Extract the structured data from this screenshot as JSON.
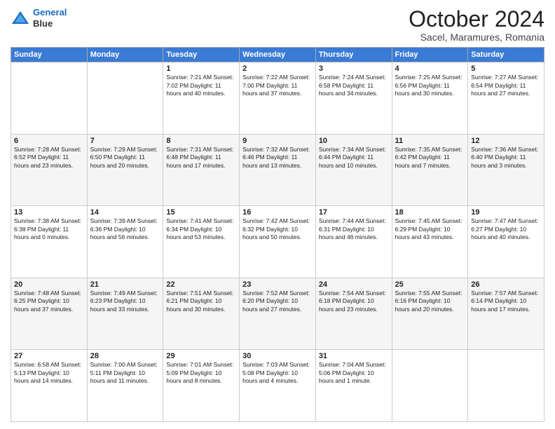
{
  "header": {
    "logo_line1": "General",
    "logo_line2": "Blue",
    "month": "October 2024",
    "location": "Sacel, Maramures, Romania"
  },
  "weekdays": [
    "Sunday",
    "Monday",
    "Tuesday",
    "Wednesday",
    "Thursday",
    "Friday",
    "Saturday"
  ],
  "weeks": [
    [
      {
        "num": "",
        "info": ""
      },
      {
        "num": "",
        "info": ""
      },
      {
        "num": "1",
        "info": "Sunrise: 7:21 AM\nSunset: 7:02 PM\nDaylight: 11 hours and 40 minutes."
      },
      {
        "num": "2",
        "info": "Sunrise: 7:22 AM\nSunset: 7:00 PM\nDaylight: 11 hours and 37 minutes."
      },
      {
        "num": "3",
        "info": "Sunrise: 7:24 AM\nSunset: 6:58 PM\nDaylight: 11 hours and 34 minutes."
      },
      {
        "num": "4",
        "info": "Sunrise: 7:25 AM\nSunset: 6:56 PM\nDaylight: 11 hours and 30 minutes."
      },
      {
        "num": "5",
        "info": "Sunrise: 7:27 AM\nSunset: 6:54 PM\nDaylight: 11 hours and 27 minutes."
      }
    ],
    [
      {
        "num": "6",
        "info": "Sunrise: 7:28 AM\nSunset: 6:52 PM\nDaylight: 11 hours and 23 minutes."
      },
      {
        "num": "7",
        "info": "Sunrise: 7:29 AM\nSunset: 6:50 PM\nDaylight: 11 hours and 20 minutes."
      },
      {
        "num": "8",
        "info": "Sunrise: 7:31 AM\nSunset: 6:48 PM\nDaylight: 11 hours and 17 minutes."
      },
      {
        "num": "9",
        "info": "Sunrise: 7:32 AM\nSunset: 6:46 PM\nDaylight: 11 hours and 13 minutes."
      },
      {
        "num": "10",
        "info": "Sunrise: 7:34 AM\nSunset: 6:44 PM\nDaylight: 11 hours and 10 minutes."
      },
      {
        "num": "11",
        "info": "Sunrise: 7:35 AM\nSunset: 6:42 PM\nDaylight: 11 hours and 7 minutes."
      },
      {
        "num": "12",
        "info": "Sunrise: 7:36 AM\nSunset: 6:40 PM\nDaylight: 11 hours and 3 minutes."
      }
    ],
    [
      {
        "num": "13",
        "info": "Sunrise: 7:38 AM\nSunset: 6:38 PM\nDaylight: 11 hours and 0 minutes."
      },
      {
        "num": "14",
        "info": "Sunrise: 7:39 AM\nSunset: 6:36 PM\nDaylight: 10 hours and 56 minutes."
      },
      {
        "num": "15",
        "info": "Sunrise: 7:41 AM\nSunset: 6:34 PM\nDaylight: 10 hours and 53 minutes."
      },
      {
        "num": "16",
        "info": "Sunrise: 7:42 AM\nSunset: 6:32 PM\nDaylight: 10 hours and 50 minutes."
      },
      {
        "num": "17",
        "info": "Sunrise: 7:44 AM\nSunset: 6:31 PM\nDaylight: 10 hours and 46 minutes."
      },
      {
        "num": "18",
        "info": "Sunrise: 7:45 AM\nSunset: 6:29 PM\nDaylight: 10 hours and 43 minutes."
      },
      {
        "num": "19",
        "info": "Sunrise: 7:47 AM\nSunset: 6:27 PM\nDaylight: 10 hours and 40 minutes."
      }
    ],
    [
      {
        "num": "20",
        "info": "Sunrise: 7:48 AM\nSunset: 6:25 PM\nDaylight: 10 hours and 37 minutes."
      },
      {
        "num": "21",
        "info": "Sunrise: 7:49 AM\nSunset: 6:23 PM\nDaylight: 10 hours and 33 minutes."
      },
      {
        "num": "22",
        "info": "Sunrise: 7:51 AM\nSunset: 6:21 PM\nDaylight: 10 hours and 30 minutes."
      },
      {
        "num": "23",
        "info": "Sunrise: 7:52 AM\nSunset: 6:20 PM\nDaylight: 10 hours and 27 minutes."
      },
      {
        "num": "24",
        "info": "Sunrise: 7:54 AM\nSunset: 6:18 PM\nDaylight: 10 hours and 23 minutes."
      },
      {
        "num": "25",
        "info": "Sunrise: 7:55 AM\nSunset: 6:16 PM\nDaylight: 10 hours and 20 minutes."
      },
      {
        "num": "26",
        "info": "Sunrise: 7:57 AM\nSunset: 6:14 PM\nDaylight: 10 hours and 17 minutes."
      }
    ],
    [
      {
        "num": "27",
        "info": "Sunrise: 6:58 AM\nSunset: 5:13 PM\nDaylight: 10 hours and 14 minutes."
      },
      {
        "num": "28",
        "info": "Sunrise: 7:00 AM\nSunset: 5:11 PM\nDaylight: 10 hours and 11 minutes."
      },
      {
        "num": "29",
        "info": "Sunrise: 7:01 AM\nSunset: 5:09 PM\nDaylight: 10 hours and 8 minutes."
      },
      {
        "num": "30",
        "info": "Sunrise: 7:03 AM\nSunset: 5:08 PM\nDaylight: 10 hours and 4 minutes."
      },
      {
        "num": "31",
        "info": "Sunrise: 7:04 AM\nSunset: 5:06 PM\nDaylight: 10 hours and 1 minute."
      },
      {
        "num": "",
        "info": ""
      },
      {
        "num": "",
        "info": ""
      }
    ]
  ]
}
